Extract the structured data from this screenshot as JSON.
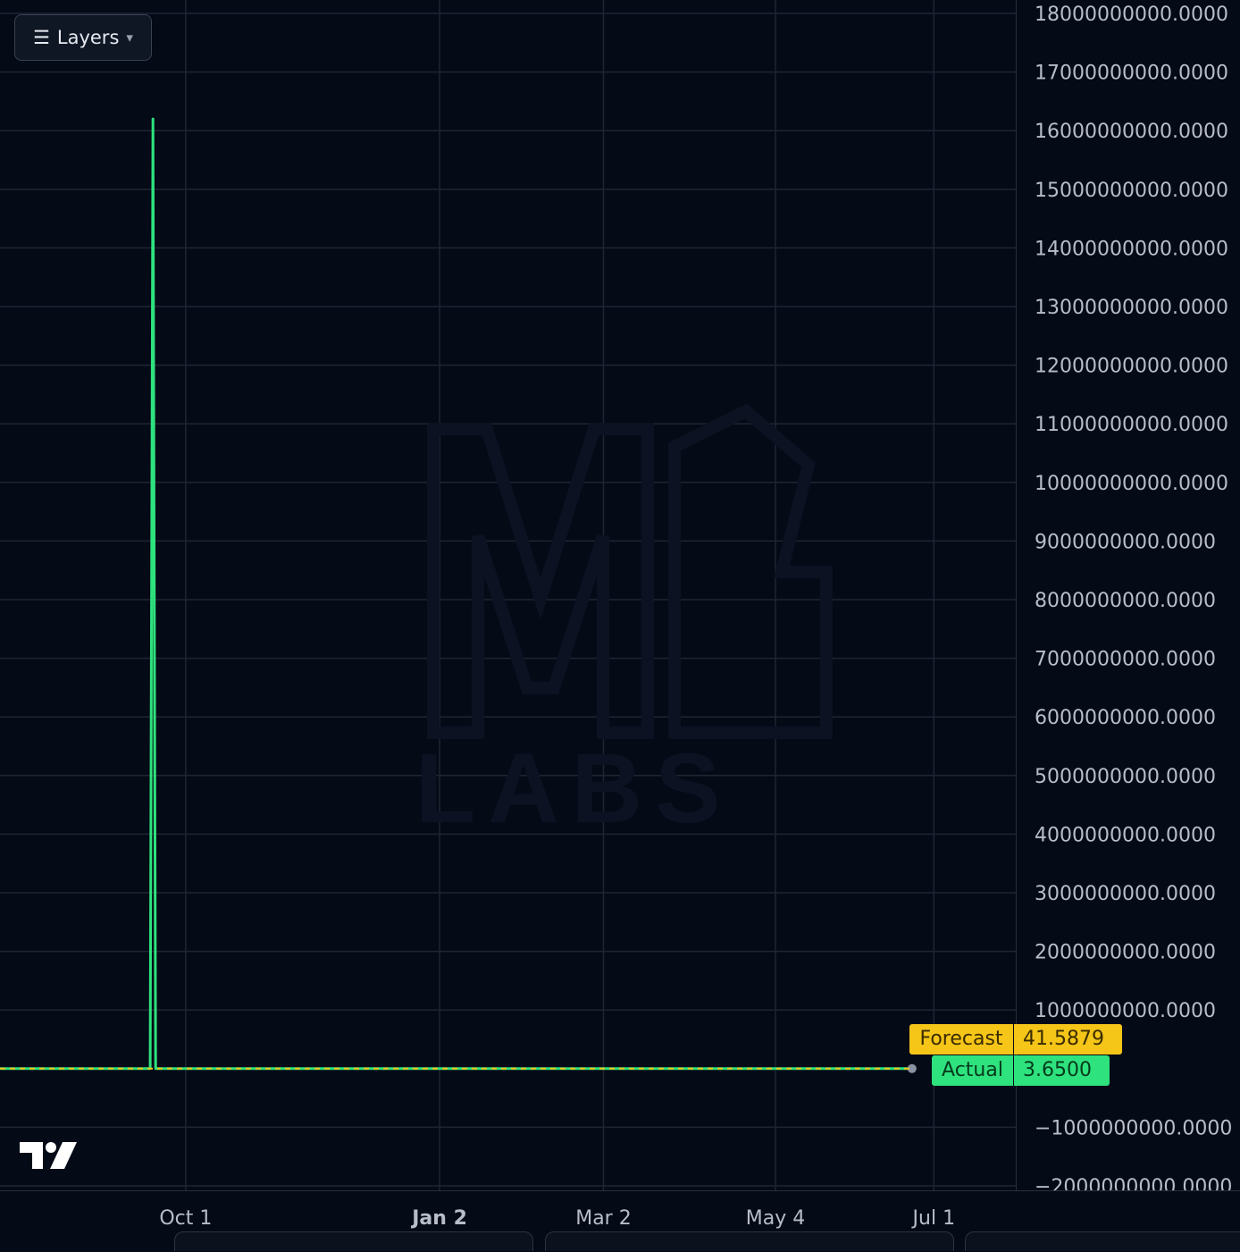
{
  "toolbar": {
    "layers_icon": "☰",
    "layers_label": "Layers",
    "layers_caret": "▾"
  },
  "watermark": {
    "text": "LABS"
  },
  "colors": {
    "background": "#050a17",
    "grid": "#1f2533",
    "actual": "#2ee27d",
    "forecast": "#f5c518",
    "axis_text": "#b8bec9"
  },
  "chart_data": {
    "type": "line",
    "x_axis_ticks": [
      "Oct 1",
      "Jan 2",
      "Mar 2",
      "May 4",
      "Jul 1"
    ],
    "y_axis_ticks": [
      "18000000000.0000",
      "17000000000.0000",
      "16000000000.0000",
      "15000000000.0000",
      "14000000000.0000",
      "13000000000.0000",
      "12000000000.0000",
      "11000000000.0000",
      "10000000000.0000",
      "9000000000.0000",
      "8000000000.0000",
      "7000000000.0000",
      "6000000000.0000",
      "5000000000.0000",
      "4000000000.0000",
      "3000000000.0000",
      "2000000000.0000",
      "1000000000.0000",
      "−1000000000.0000",
      "−2000000000.0000"
    ],
    "ylim": [
      -2000000000,
      18000000000
    ],
    "xlim": [
      "2023-07-25",
      "2024-07-31"
    ],
    "series": [
      {
        "name": "Actual",
        "color": "#2ee27d",
        "points": [
          {
            "x": "2023-07-25",
            "y": 3.65
          },
          {
            "x": "2023-09-18",
            "y": 3.65
          },
          {
            "x": "2023-09-19",
            "y": 16200000000
          },
          {
            "x": "2023-09-20",
            "y": 3.65
          },
          {
            "x": "2024-06-23",
            "y": 3.65
          }
        ],
        "last_value_label": "3.6500"
      },
      {
        "name": "Forecast",
        "color": "#f5c518",
        "dashed": true,
        "points": [
          {
            "x": "2023-07-25",
            "y": 41.5879
          },
          {
            "x": "2024-06-23",
            "y": 41.5879
          }
        ],
        "last_value_label": "41.5879"
      }
    ]
  }
}
